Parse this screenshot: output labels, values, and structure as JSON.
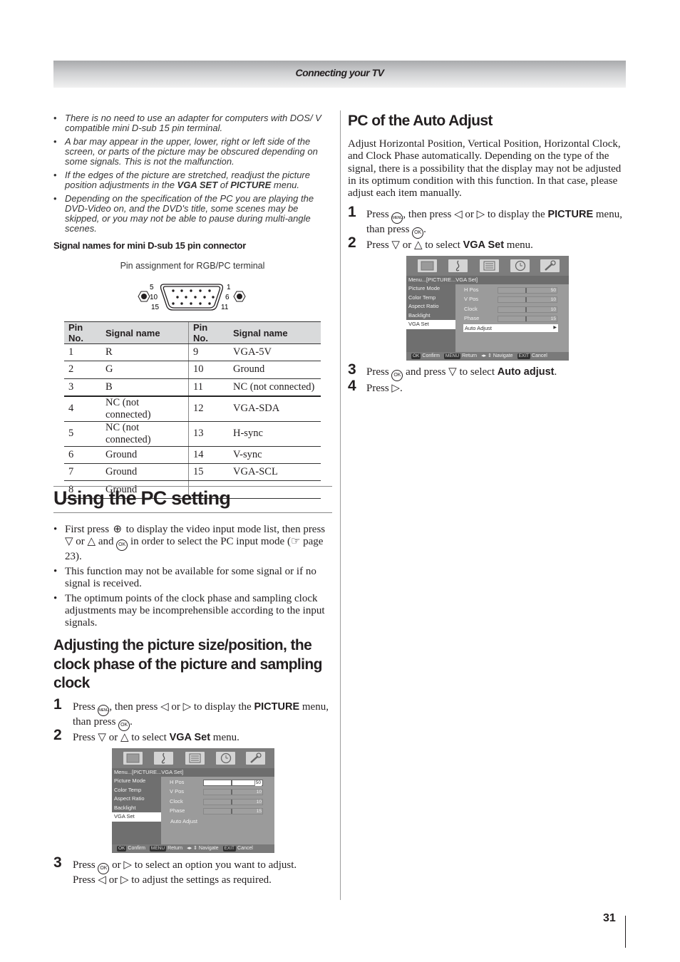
{
  "header": {
    "section_title": "Connecting your TV"
  },
  "notes": [
    {
      "pre": "There is no need to use an adapter for computers with DOS/ V compatible mini D-sub 15 pin terminal."
    },
    {
      "pre": "A bar may appear in the upper, lower, right or left side of the screen, or parts of the picture may be obscured depending on some signals. This is not the malfunction."
    },
    {
      "pre": "If the edges of the picture are stretched, readjust the picture position adjustments in the ",
      "b1": "VGA SET",
      "mid": " of ",
      "b2": "PICTURE",
      "post": " menu."
    },
    {
      "pre": "Depending on the specification of the PC you are playing the DVD-Video on, and the DVD's title, some scenes may be skipped, or you may not be able to pause during multi-angle scenes."
    }
  ],
  "bullet_char": "•",
  "pin_section": {
    "title": "Signal names for mini D-sub 15 pin connector",
    "caption": "Pin assignment for RGB/PC terminal",
    "connector_labels": {
      "top_left": "5",
      "mid_left": "10",
      "bottom_left": "15",
      "top_right": "1",
      "mid_right": "6",
      "bottom_right": "11"
    },
    "table": {
      "headers": [
        "Pin No.",
        "Signal name",
        "Pin No.",
        "Signal name"
      ],
      "rows": [
        [
          "1",
          "R",
          "9",
          "VGA-5V"
        ],
        [
          "2",
          "G",
          "10",
          "Ground"
        ],
        [
          "3",
          "B",
          "11",
          "NC (not connected)"
        ],
        [
          "4",
          "NC (not connected)",
          "12",
          "VGA-SDA"
        ],
        [
          "5",
          "NC (not connected)",
          "13",
          "H-sync"
        ],
        [
          "6",
          "Ground",
          "14",
          "V-sync"
        ],
        [
          "7",
          "Ground",
          "15",
          "VGA-SCL"
        ],
        [
          "8",
          "Ground",
          "",
          ""
        ]
      ]
    }
  },
  "pc_setting": {
    "title": "Using the PC setting",
    "bullets": [
      {
        "a": "First press ",
        "b": " to display the video input mode list, then press ▽ or △ and ",
        "c": " in order to select the PC input mode (☞ page 23)."
      },
      {
        "a": "This function may not be available for some signal or if no signal is received."
      },
      {
        "a": "The optimum points of the clock phase and sampling clock adjustments may be incomprehensible according to the input signals."
      }
    ]
  },
  "adjust_section": {
    "title_lines": [
      "Adjusting the picture size/position, the",
      "clock phase of the picture and sampling",
      "clock"
    ],
    "steps": [
      {
        "num": "1",
        "a": "Press ",
        "b": ", then press ◁ or ▷ to display the ",
        "bold": "PICTURE",
        "c": " menu, than press ",
        "d": "."
      },
      {
        "num": "2",
        "a": "Press ▽ or △ to select ",
        "bold": "VGA Set",
        "c": " menu."
      },
      {
        "num": "3",
        "a": "Press ",
        "b": " or ▷ to select an option you want to adjust.",
        "line2": "Press ◁ or ▷ to adjust the settings as required."
      }
    ]
  },
  "auto_adjust_section": {
    "title": "PC of the Auto Adjust",
    "paragraph": "Adjust Horizontal Position, Vertical Position, Horizontal Clock, and Clock Phase automatically. Depending on the type of the signal, there is a possibility that the display may not be adjusted in its optimum condition with this function. In that case, please adjust each item manually.",
    "steps": [
      {
        "num": "1",
        "a": "Press ",
        "b": ", then press ◁ or ▷ to display the ",
        "bold": "PICTURE",
        "c": " menu, than press ",
        "d": "."
      },
      {
        "num": "2",
        "a": "Press ▽ or △ to select ",
        "bold": "VGA Set",
        "c": " menu."
      },
      {
        "num": "3",
        "a": "Press ",
        "b": " and press ▽ to select ",
        "bold": "Auto adjust",
        "c": "."
      },
      {
        "num": "4",
        "a": "Press ▷."
      }
    ]
  },
  "buttons": {
    "ok": "OK",
    "menu": "MENU"
  },
  "osd": {
    "breadcrumb": "Menu...[PICTURE...VGA Set]",
    "icons": [
      "picture-icon",
      "sound-icon",
      "setup-icon",
      "timer-icon",
      "tools-icon"
    ],
    "left_menu": [
      "Picture Mode",
      "Color Temp",
      "Aspect Ratio",
      "Backlight",
      "VGA Set"
    ],
    "left_selected": "VGA Set",
    "settings": [
      {
        "label": "H Pos",
        "value": "50"
      },
      {
        "label": "V Pos",
        "value": "10"
      },
      {
        "label": "Clock",
        "value": "10"
      },
      {
        "label": "Phase",
        "value": "15"
      }
    ],
    "auto_adjust": "Auto Adjust",
    "footer": {
      "ok_key": "OK",
      "ok_label": "Confirm",
      "menu_key": "MENU",
      "menu_label": "Return",
      "nav_symbol": "◂▸ ⇕",
      "nav_label": "Navigate",
      "exit_key": "EXIT",
      "exit_label": "Cancel"
    }
  },
  "page_number": "31"
}
